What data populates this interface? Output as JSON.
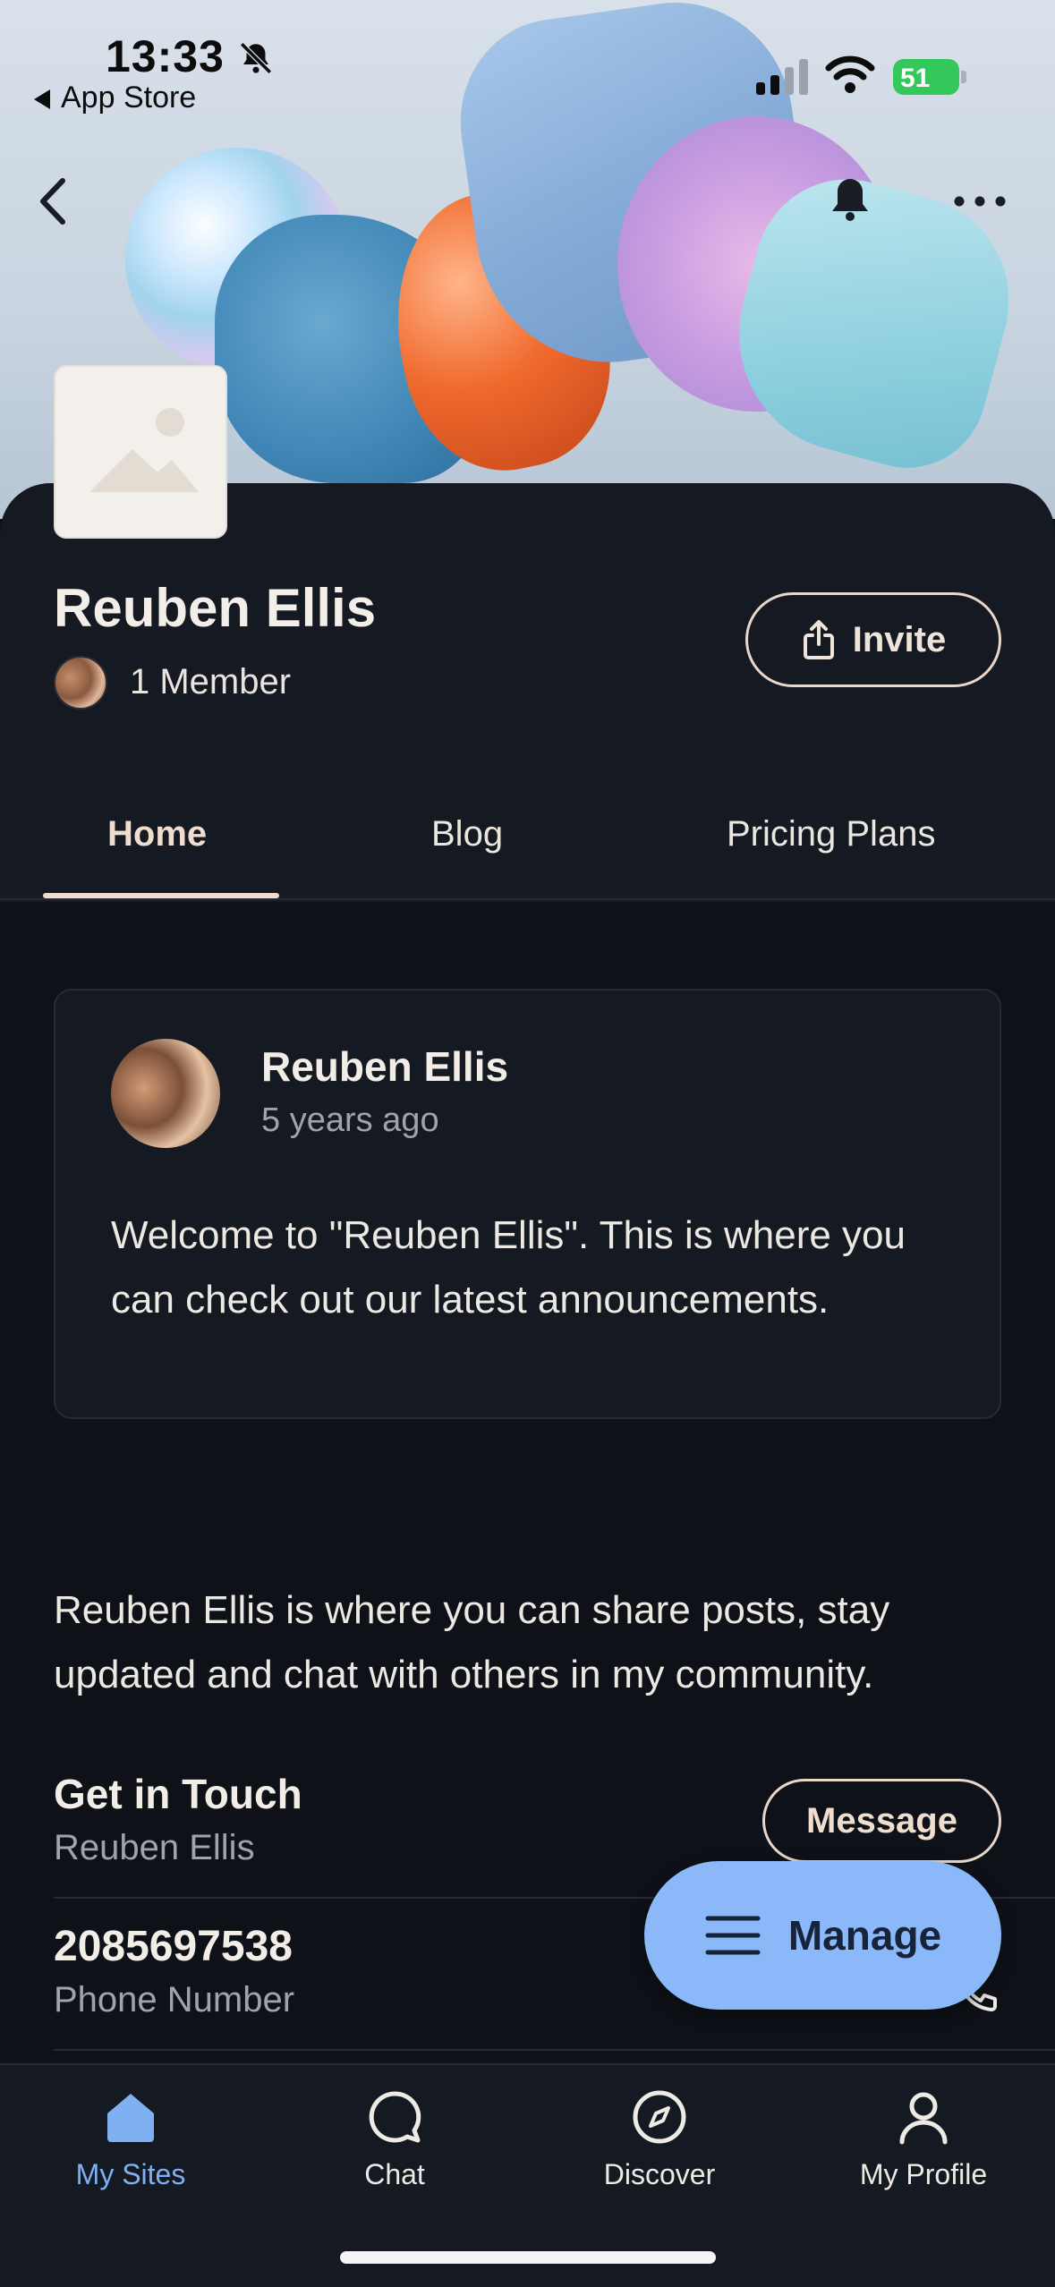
{
  "status_bar": {
    "time": "13:33",
    "back_app": "App Store",
    "battery": "51"
  },
  "group": {
    "title": "Reuben Ellis",
    "member_count": "1 Member",
    "invite_label": "Invite"
  },
  "tabs": [
    {
      "label": "Home",
      "active": true
    },
    {
      "label": "Blog",
      "active": false
    },
    {
      "label": "Pricing Plans",
      "active": false
    }
  ],
  "post": {
    "author": "Reuben Ellis",
    "time": "5 years ago",
    "body": "Welcome to \"Reuben Ellis\". This is where you can check out our latest announcements."
  },
  "about": {
    "text": "Reuben Ellis is where you can share posts, stay updated and chat with others in my community."
  },
  "contact": {
    "title": "Get in Touch",
    "subtitle": "Reuben Ellis",
    "message_label": "Message",
    "phone": "2085697538",
    "phone_label": "Phone Number"
  },
  "fab": {
    "label": "Manage"
  },
  "bottom_nav": [
    {
      "label": "My Sites",
      "icon": "home-icon",
      "active": true
    },
    {
      "label": "Chat",
      "icon": "chat-icon",
      "active": false
    },
    {
      "label": "Discover",
      "icon": "compass-icon",
      "active": false
    },
    {
      "label": "My Profile",
      "icon": "person-icon",
      "active": false
    }
  ],
  "colors": {
    "background": "#0e1117",
    "surface": "#151922",
    "accent_tab": "#efddcf",
    "fab": "#8ab8f8",
    "nav_active": "#7fb0f2"
  }
}
